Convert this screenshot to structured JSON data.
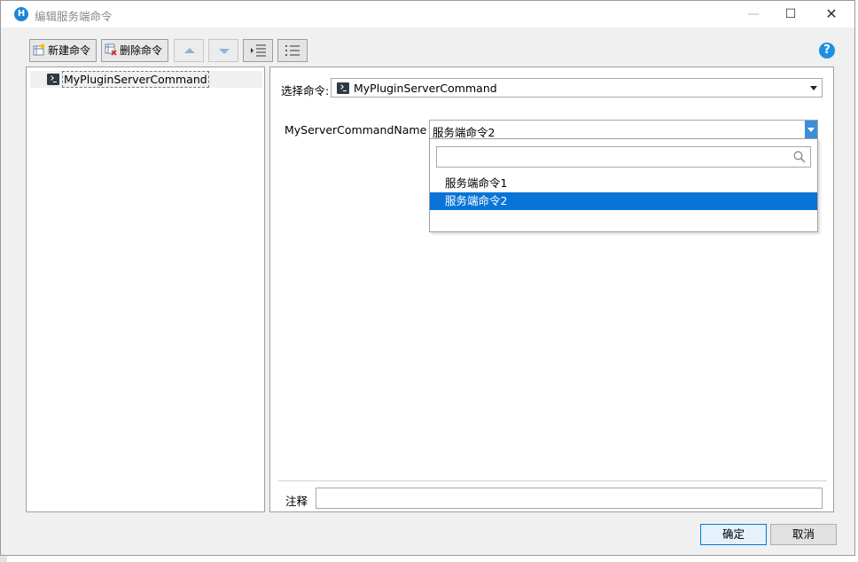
{
  "window": {
    "title": "编辑服务端命令"
  },
  "toolbar": {
    "new_label": "新建命令",
    "delete_label": "删除命令"
  },
  "tree": {
    "items": [
      {
        "label": "MyPluginServerCommand"
      }
    ]
  },
  "form": {
    "select_command_label": "选择命令:",
    "select_command_value": "MyPluginServerCommand",
    "param_label": "MyServerCommandName",
    "param_value": "服务端命令2",
    "dropdown": {
      "search_value": "",
      "options": [
        "服务端命令1",
        "服务端命令2"
      ],
      "selected_index": 1
    },
    "note_label": "注释",
    "note_value": ""
  },
  "buttons": {
    "ok_label": "确定",
    "cancel_label": "取消"
  },
  "colors": {
    "accent": "#0a74d6",
    "help": "#1e90e0"
  }
}
